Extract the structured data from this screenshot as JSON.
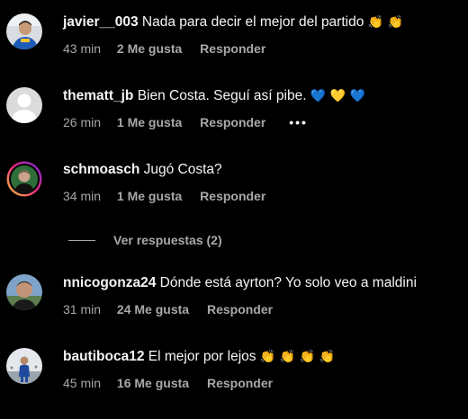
{
  "comments": [
    {
      "username": "javier__003",
      "text": "Nada para decir el mejor del partido",
      "emojis": "👏 👏",
      "time": "43 min",
      "likes": "2 Me gusta",
      "reply": "Responder",
      "avatar_icon": "user-photo-icon"
    },
    {
      "username": "thematt_jb",
      "text": "Bien Costa. Seguí así pibe.",
      "emojis": "💙 💛 💙",
      "time": "26 min",
      "likes": "1 Me gusta",
      "reply": "Responder",
      "more": "•••",
      "avatar_icon": "default-avatar-icon"
    },
    {
      "username": "schmoasch",
      "text": "Jugó Costa?",
      "emojis": "",
      "time": "34 min",
      "likes": "1 Me gusta",
      "reply": "Responder",
      "avatar_icon": "story-ring-avatar-icon"
    },
    {
      "username": "nnicogonza24",
      "text": "Dónde está ayrton? Yo solo veo a maldini",
      "emojis": "",
      "time": "31 min",
      "likes": "24 Me gusta",
      "reply": "Responder",
      "avatar_icon": "user-photo-icon"
    },
    {
      "username": "bautiboca12",
      "text": "El mejor por lejos",
      "emojis": "👏 👏 👏 👏",
      "time": "45 min",
      "likes": "16 Me gusta",
      "reply": "Responder",
      "avatar_icon": "user-photo-icon"
    }
  ],
  "view_replies": "Ver respuestas (2)",
  "colors": {
    "background": "#000000",
    "primary_text": "#f5f5f5",
    "secondary_text": "#a8a8a8",
    "story_ring": "#c13584"
  }
}
